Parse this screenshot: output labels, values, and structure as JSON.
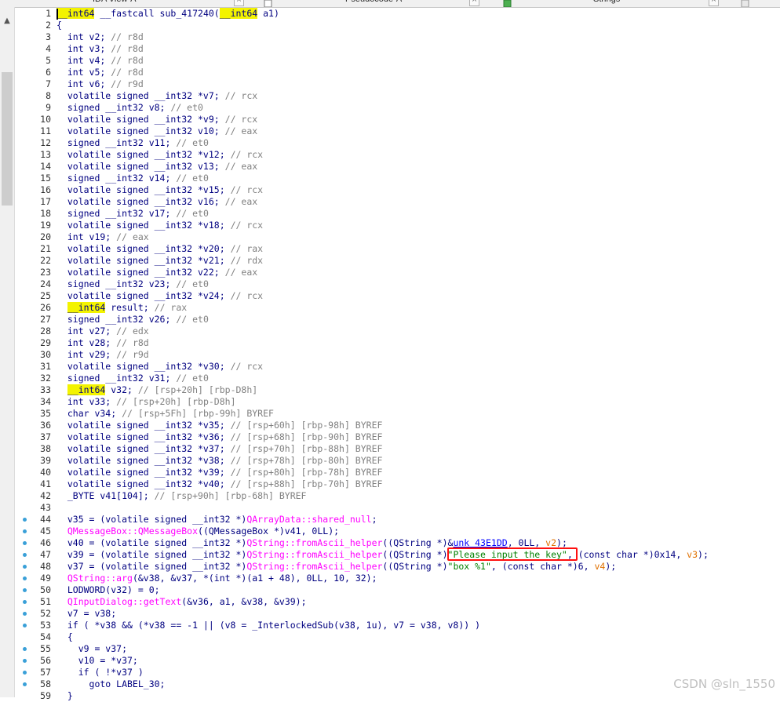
{
  "tabs": [
    {
      "label": "IDA View-A"
    },
    {
      "label": "Pseudocode-A"
    },
    {
      "label": "Strings"
    }
  ],
  "watermark": "CSDN @sln_1550",
  "colors": {
    "keyword_highlight": "#f3f300",
    "annotation_box": "#ff1010",
    "breakpoint_dot": "#3aa0d8"
  },
  "lines": [
    {
      "n": "1",
      "t": "__int64 __fastcall sub_417240(__int64 a1)"
    },
    {
      "n": "2",
      "t": "{"
    },
    {
      "n": "3",
      "t": "  int v2; // r8d"
    },
    {
      "n": "4",
      "t": "  int v3; // r8d"
    },
    {
      "n": "5",
      "t": "  int v4; // r8d"
    },
    {
      "n": "6",
      "t": "  int v5; // r8d"
    },
    {
      "n": "7",
      "t": "  int v6; // r9d"
    },
    {
      "n": "8",
      "t": "  volatile signed __int32 *v7; // rcx"
    },
    {
      "n": "9",
      "t": "  signed __int32 v8; // et0"
    },
    {
      "n": "10",
      "t": "  volatile signed __int32 *v9; // rcx"
    },
    {
      "n": "11",
      "t": "  volatile signed __int32 v10; // eax"
    },
    {
      "n": "12",
      "t": "  signed __int32 v11; // et0"
    },
    {
      "n": "13",
      "t": "  volatile signed __int32 *v12; // rcx"
    },
    {
      "n": "14",
      "t": "  volatile signed __int32 v13; // eax"
    },
    {
      "n": "15",
      "t": "  signed __int32 v14; // et0"
    },
    {
      "n": "16",
      "t": "  volatile signed __int32 *v15; // rcx"
    },
    {
      "n": "17",
      "t": "  volatile signed __int32 v16; // eax"
    },
    {
      "n": "18",
      "t": "  signed __int32 v17; // et0"
    },
    {
      "n": "19",
      "t": "  volatile signed __int32 *v18; // rcx"
    },
    {
      "n": "20",
      "t": "  int v19; // eax"
    },
    {
      "n": "21",
      "t": "  volatile signed __int32 *v20; // rax"
    },
    {
      "n": "22",
      "t": "  volatile signed __int32 *v21; // rdx"
    },
    {
      "n": "23",
      "t": "  volatile signed __int32 v22; // eax"
    },
    {
      "n": "24",
      "t": "  signed __int32 v23; // et0"
    },
    {
      "n": "25",
      "t": "  volatile signed __int32 *v24; // rcx"
    },
    {
      "n": "26",
      "t": "  __int64 result; // rax"
    },
    {
      "n": "27",
      "t": "  signed __int32 v26; // et0"
    },
    {
      "n": "28",
      "t": "  int v27; // edx"
    },
    {
      "n": "29",
      "t": "  int v28; // r8d"
    },
    {
      "n": "30",
      "t": "  int v29; // r9d"
    },
    {
      "n": "31",
      "t": "  volatile signed __int32 *v30; // rcx"
    },
    {
      "n": "32",
      "t": "  signed __int32 v31; // et0"
    },
    {
      "n": "33",
      "t": "  __int64 v32; // [rsp+20h] [rbp-D8h]"
    },
    {
      "n": "34",
      "t": "  int v33; // [rsp+20h] [rbp-D8h]"
    },
    {
      "n": "35",
      "t": "  char v34; // [rsp+5Fh] [rbp-99h] BYREF"
    },
    {
      "n": "36",
      "t": "  volatile signed __int32 *v35; // [rsp+60h] [rbp-98h] BYREF"
    },
    {
      "n": "37",
      "t": "  volatile signed __int32 *v36; // [rsp+68h] [rbp-90h] BYREF"
    },
    {
      "n": "38",
      "t": "  volatile signed __int32 *v37; // [rsp+70h] [rbp-88h] BYREF"
    },
    {
      "n": "39",
      "t": "  volatile signed __int32 *v38; // [rsp+78h] [rbp-80h] BYREF"
    },
    {
      "n": "40",
      "t": "  volatile signed __int32 *v39; // [rsp+80h] [rbp-78h] BYREF"
    },
    {
      "n": "41",
      "t": "  volatile signed __int32 *v40; // [rsp+88h] [rbp-70h] BYREF"
    },
    {
      "n": "42",
      "t": "  _BYTE v41[104]; // [rsp+90h] [rbp-68h] BYREF"
    },
    {
      "n": "43",
      "t": ""
    },
    {
      "n": "44",
      "t": "  v35 = (volatile signed __int32 *)QArrayData::shared_null;"
    },
    {
      "n": "45",
      "t": "  QMessageBox::QMessageBox((QMessageBox *)v41, 0LL);"
    },
    {
      "n": "46",
      "t": "  v40 = (volatile signed __int32 *)QString::fromAscii_helper((QString *)&unk_43E1DD, 0LL, v2);"
    },
    {
      "n": "47",
      "t": "  v39 = (volatile signed __int32 *)QString::fromAscii_helper((QString *)\"Please input the key\", (const char *)0x14, v3);"
    },
    {
      "n": "48",
      "t": "  v37 = (volatile signed __int32 *)QString::fromAscii_helper((QString *)\"box %1\", (const char *)6, v4);"
    },
    {
      "n": "49",
      "t": "  QString::arg(&v38, &v37, *(int *)(a1 + 48), 0LL, 10, 32);"
    },
    {
      "n": "50",
      "t": "  LODWORD(v32) = 0;"
    },
    {
      "n": "51",
      "t": "  QInputDialog::getText(&v36, a1, &v38, &v39);"
    },
    {
      "n": "52",
      "t": "  v7 = v38;"
    },
    {
      "n": "53",
      "t": "  if ( *v38 && (*v38 == -1 || (v8 = _InterlockedSub(v38, 1u), v7 = v38, v8)) )"
    },
    {
      "n": "54",
      "t": "  {"
    },
    {
      "n": "55",
      "t": "    v9 = v37;"
    },
    {
      "n": "56",
      "t": "    v10 = *v37;"
    },
    {
      "n": "57",
      "t": "    if ( !*v37 )"
    },
    {
      "n": "58",
      "t": "      goto LABEL_30;"
    },
    {
      "n": "59",
      "t": "  }"
    }
  ]
}
